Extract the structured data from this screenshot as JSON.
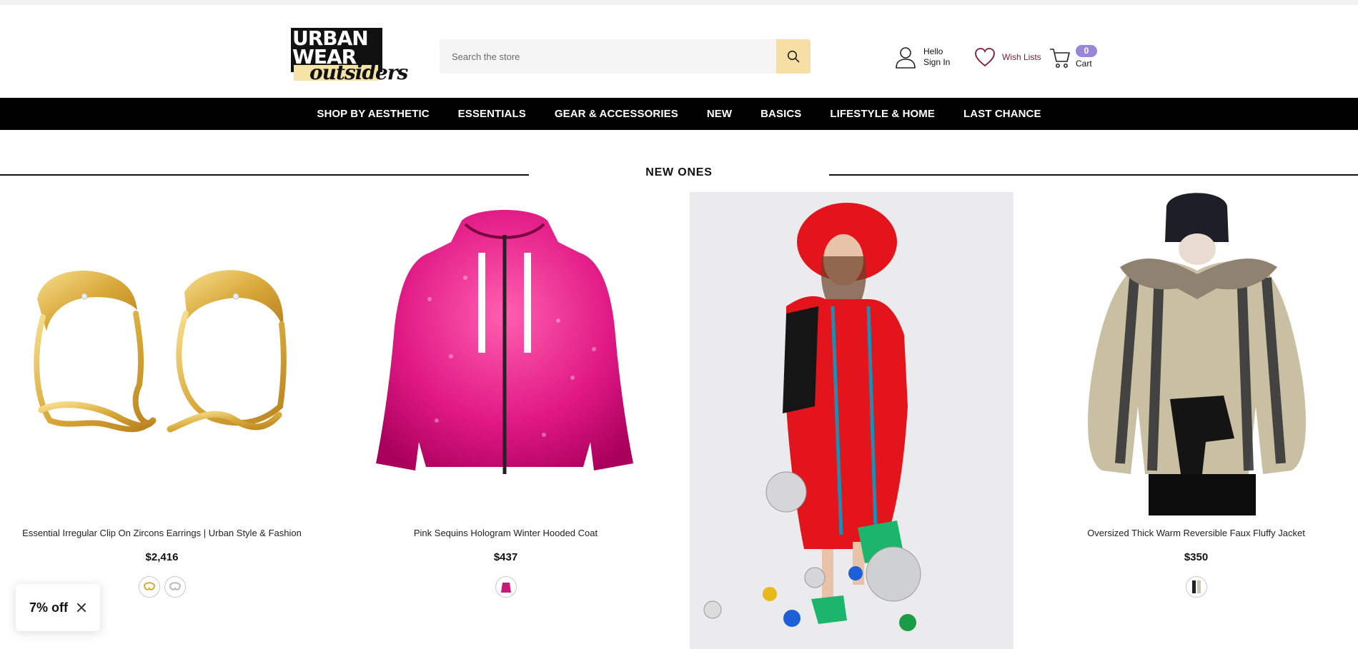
{
  "brand": {
    "logo_lines": [
      "URBAN",
      "WEAR",
      "outsiders"
    ]
  },
  "search": {
    "placeholder": "Search the store"
  },
  "account": {
    "greeting": "Hello",
    "action": "Sign In"
  },
  "wishlist": {
    "label": "Wish Lists",
    "color": "#7b1d3a"
  },
  "cart": {
    "count": "0",
    "label": "Cart",
    "badge_color": "#9a86d6"
  },
  "accent": {
    "search_button": "#f6dfa5"
  },
  "nav": {
    "items": [
      {
        "label": "SHOP BY AESTHETIC"
      },
      {
        "label": "ESSENTIALS"
      },
      {
        "label": "GEAR & ACCESSORIES"
      },
      {
        "label": "NEW"
      },
      {
        "label": "BASICS"
      },
      {
        "label": "LIFESTYLE & HOME"
      },
      {
        "label": "LAST CHANCE"
      }
    ]
  },
  "section": {
    "title": "NEW ONES"
  },
  "products": [
    {
      "name": "Essential Irregular Clip On Zircons Earrings | Urban Style & Fashion",
      "price": "$2,416",
      "image": "gold-earrings-image",
      "swatches": [
        "gold",
        "silver"
      ]
    },
    {
      "name": "Pink Sequins Hologram Winter Hooded Coat",
      "price": "$437",
      "image": "pink-sequin-coat-image",
      "swatches": [
        "pink"
      ]
    },
    {
      "name": "",
      "price": "",
      "image": "red-fur-coat-model-image",
      "swatches": []
    },
    {
      "name": "Oversized Thick Warm Reversible Faux Fluffy Jacket",
      "price": "$350",
      "image": "faux-fur-jacket-image",
      "swatches": [
        "black-cream"
      ]
    }
  ],
  "popup": {
    "label": "7% off"
  }
}
